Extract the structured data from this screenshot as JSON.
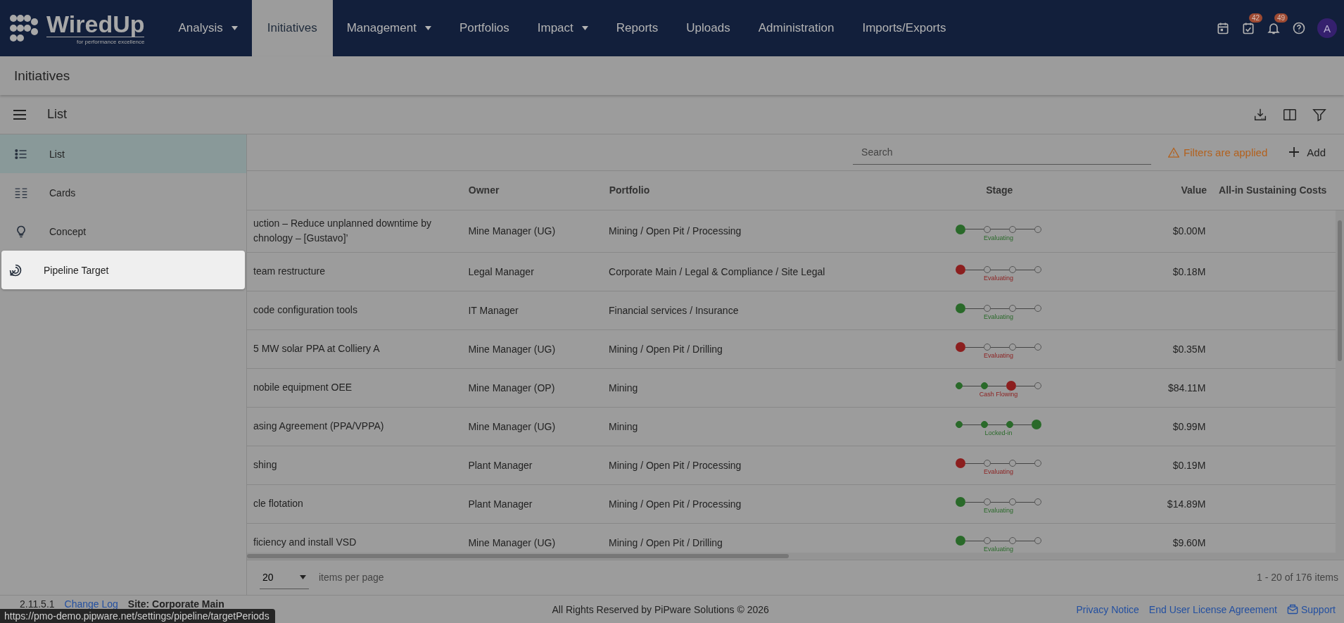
{
  "logo": {
    "name": "WiredUp",
    "tagline": "for performance excellence"
  },
  "nav": [
    {
      "label": "Analysis",
      "menu": true,
      "selected": false
    },
    {
      "label": "Initiatives",
      "menu": false,
      "selected": true
    },
    {
      "label": "Management",
      "menu": true,
      "selected": false
    },
    {
      "label": "Portfolios",
      "menu": false,
      "selected": false
    },
    {
      "label": "Impact",
      "menu": true,
      "selected": false
    },
    {
      "label": "Reports",
      "menu": false,
      "selected": false
    },
    {
      "label": "Uploads",
      "menu": false,
      "selected": false
    },
    {
      "label": "Administration",
      "menu": false,
      "selected": false
    },
    {
      "label": "Imports/Exports",
      "menu": false,
      "selected": false
    }
  ],
  "header_icons": [
    {
      "kind": "calendar"
    },
    {
      "kind": "tasks",
      "badge": "42"
    },
    {
      "kind": "bell",
      "badge": "49"
    },
    {
      "kind": "help"
    }
  ],
  "avatar": "A",
  "page_title": "Initiatives",
  "view_title": "List",
  "drawer": [
    {
      "label": "List",
      "kind": "list",
      "selected": true,
      "hovered": false
    },
    {
      "label": "Cards",
      "kind": "cards",
      "selected": false,
      "hovered": false
    },
    {
      "label": "Concept",
      "kind": "concept",
      "selected": false,
      "hovered": false
    },
    {
      "label": "Pipeline Target",
      "kind": "target",
      "selected": false,
      "hovered": true
    }
  ],
  "search": {
    "placeholder": "Search"
  },
  "filters_notice": "Filters are applied",
  "add_button": "Add",
  "table": {
    "columns": [
      "Owner",
      "Portfolio",
      "Stage",
      "Value",
      "All-in Sustaining Costs"
    ],
    "rows": [
      {
        "title": [
          "uction – Reduce unplanned downtime by",
          "chnology – [Gustavo]’"
        ],
        "owner": "Mine Manager (UG)",
        "portfolio": "Mining / Open Pit / Processing",
        "stage": {
          "label": "Evaluating",
          "color": "#2a6a2a",
          "steps": [
            {
              "reached": true,
              "current": true
            },
            {
              "reached": false,
              "current": false
            },
            {
              "reached": false,
              "current": false
            },
            {
              "reached": false,
              "current": false
            }
          ]
        },
        "value": "$0.00M"
      },
      {
        "title": [
          "team restructure"
        ],
        "owner": "Legal Manager",
        "portfolio": "Corporate Main / Legal & Compliance / Site Legal",
        "stage": {
          "label": "Evaluating",
          "color": "#8c1f1f",
          "steps": [
            {
              "reached": true,
              "current": true
            },
            {
              "reached": false,
              "current": false
            },
            {
              "reached": false,
              "current": false
            },
            {
              "reached": false,
              "current": false
            }
          ]
        },
        "value": "$0.18M"
      },
      {
        "title": [
          "code configuration tools"
        ],
        "owner": "IT Manager",
        "portfolio": "Financial services / Insurance",
        "stage": {
          "label": "Evaluating",
          "color": "#2a6a2a",
          "steps": [
            {
              "reached": true,
              "current": true
            },
            {
              "reached": false,
              "current": false
            },
            {
              "reached": false,
              "current": false
            },
            {
              "reached": false,
              "current": false
            }
          ]
        }
      },
      {
        "title": [
          "5 MW solar PPA at Colliery A"
        ],
        "owner": "Mine Manager (UG)",
        "portfolio": "Mining / Open Pit / Drilling",
        "stage": {
          "label": "Evaluating",
          "color": "#8c1f1f",
          "steps": [
            {
              "reached": true,
              "current": true
            },
            {
              "reached": false,
              "current": false
            },
            {
              "reached": false,
              "current": false
            },
            {
              "reached": false,
              "current": false
            }
          ]
        },
        "value": "$0.35M"
      },
      {
        "title": [
          "nobile equipment OEE"
        ],
        "owner": "Mine Manager (OP)",
        "portfolio": "Mining",
        "stage": {
          "label": "Cash Flowing",
          "color": "#8c1f1f",
          "steps": [
            {
              "reached": true,
              "current": false
            },
            {
              "reached": true,
              "current": false
            },
            {
              "reached": true,
              "current": true
            },
            {
              "reached": false,
              "current": false
            }
          ]
        },
        "value": "$84.11M"
      },
      {
        "title": [
          "asing Agreement (PPA/VPPA)"
        ],
        "owner": "Mine Manager (UG)",
        "portfolio": "Mining",
        "stage": {
          "label": "Locked-in",
          "color": "#2a6a2a",
          "steps": [
            {
              "reached": true,
              "current": false
            },
            {
              "reached": true,
              "current": false
            },
            {
              "reached": true,
              "current": false
            },
            {
              "reached": true,
              "current": true
            }
          ]
        },
        "value": "$0.99M"
      },
      {
        "title": [
          "shing"
        ],
        "owner": "Plant Manager",
        "portfolio": "Mining / Open Pit / Processing",
        "stage": {
          "label": "Evaluating",
          "color": "#8c1f1f",
          "steps": [
            {
              "reached": true,
              "current": true
            },
            {
              "reached": false,
              "current": false
            },
            {
              "reached": false,
              "current": false
            },
            {
              "reached": false,
              "current": false
            }
          ]
        },
        "value": "$0.19M"
      },
      {
        "title": [
          "cle flotation"
        ],
        "owner": "Plant Manager",
        "portfolio": "Mining / Open Pit / Processing",
        "stage": {
          "label": "Evaluating",
          "color": "#2a6a2a",
          "steps": [
            {
              "reached": true,
              "current": true
            },
            {
              "reached": false,
              "current": false
            },
            {
              "reached": false,
              "current": false
            },
            {
              "reached": false,
              "current": false
            }
          ]
        },
        "value": "$14.89M"
      },
      {
        "title": [
          "ficiency and install VSD"
        ],
        "owner": "Mine Manager (UG)",
        "portfolio": "Mining / Open Pit / Drilling",
        "stage": {
          "label": "Evaluating",
          "color": "#2a6a2a",
          "steps": [
            {
              "reached": true,
              "current": true
            },
            {
              "reached": false,
              "current": false
            },
            {
              "reached": false,
              "current": false
            },
            {
              "reached": false,
              "current": false
            }
          ]
        },
        "value": "$9.60M"
      }
    ]
  },
  "paginator": {
    "page_size": "20",
    "page_size_label": "items per page",
    "range": "1 - 20 of 176 items"
  },
  "footer": {
    "version": "2.11.5.1",
    "changelog": "Change Log",
    "site": "Site: Corporate Main",
    "copyright": "All Rights Reserved by PiPware Solutions © 2026",
    "links": [
      {
        "label": "Privacy Notice",
        "kind": "plain"
      },
      {
        "label": "End User License Agreement",
        "kind": "plain"
      },
      {
        "label": "Support",
        "kind": "support"
      }
    ]
  },
  "status_url": "https://pmo-demo.pipware.net/settings/pipeline/targetPeriods"
}
